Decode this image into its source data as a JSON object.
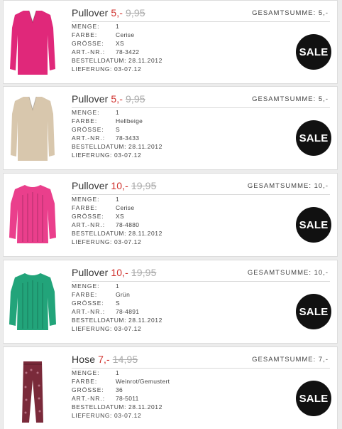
{
  "items": [
    {
      "name": "Pullover",
      "price": "5,-",
      "old_price": "9,95",
      "total_label": "GESAMTSUMME:",
      "total": "5,-",
      "menge_label": "MENGE:",
      "menge": "1",
      "farbe_label": "FARBE:",
      "farbe": "Cerise",
      "groesse_label": "GRÖSSE:",
      "groesse": "XS",
      "art_label": "ART.-NR.:",
      "art": "78-3422",
      "bestell_label": "BESTELLDATUM:",
      "bestell": "28.11.2012",
      "lieferung_label": "LIEFERUNG:",
      "lieferung": "03-07.12",
      "badge": "SALE",
      "color": "#e0287a",
      "garment": "sweater-vneck-icon"
    },
    {
      "name": "Pullover",
      "price": "5,-",
      "old_price": "9,95",
      "total_label": "GESAMTSUMME:",
      "total": "5,-",
      "menge_label": "MENGE:",
      "menge": "1",
      "farbe_label": "FARBE:",
      "farbe": "Hellbeige",
      "groesse_label": "GRÖSSE:",
      "groesse": "S",
      "art_label": "ART.-NR.:",
      "art": "78-3433",
      "bestell_label": "BESTELLDATUM:",
      "bestell": "28.11.2012",
      "lieferung_label": "LIEFERUNG:",
      "lieferung": "03-07.12",
      "badge": "SALE",
      "color": "#d8c7ad",
      "garment": "sweater-vneck-icon"
    },
    {
      "name": "Pullover",
      "price": "10,-",
      "old_price": "19,95",
      "total_label": "GESAMTSUMME:",
      "total": "10,-",
      "menge_label": "MENGE:",
      "menge": "1",
      "farbe_label": "FARBE:",
      "farbe": "Cerise",
      "groesse_label": "GRÖSSE:",
      "groesse": "XS",
      "art_label": "ART.-NR.:",
      "art": "78-4880",
      "bestell_label": "BESTELLDATUM:",
      "bestell": "28.11.2012",
      "lieferung_label": "LIEFERUNG:",
      "lieferung": "03-07.12",
      "badge": "SALE",
      "color": "#ea3f8c",
      "garment": "sweater-cable-icon"
    },
    {
      "name": "Pullover",
      "price": "10,-",
      "old_price": "19,95",
      "total_label": "GESAMTSUMME:",
      "total": "10,-",
      "menge_label": "MENGE:",
      "menge": "1",
      "farbe_label": "FARBE:",
      "farbe": "Grün",
      "groesse_label": "GRÖSSE:",
      "groesse": "S",
      "art_label": "ART.-NR.:",
      "art": "78-4891",
      "bestell_label": "BESTELLDATUM:",
      "bestell": "28.11.2012",
      "lieferung_label": "LIEFERUNG:",
      "lieferung": "03-07.12",
      "badge": "SALE",
      "color": "#22a47a",
      "garment": "sweater-cable-icon"
    },
    {
      "name": "Hose",
      "price": "7,-",
      "old_price": "14,95",
      "total_label": "GESAMTSUMME:",
      "total": "7,-",
      "menge_label": "MENGE:",
      "menge": "1",
      "farbe_label": "FARBE:",
      "farbe": "Weinrot/Gemustert",
      "groesse_label": "GRÖSSE:",
      "groesse": "36",
      "art_label": "ART.-NR.:",
      "art": "78-5011",
      "bestell_label": "BESTELLDATUM:",
      "bestell": "28.11.2012",
      "lieferung_label": "LIEFERUNG:",
      "lieferung": "03-07.12",
      "badge": "SALE",
      "color": "#7a2a3a",
      "garment": "trousers-icon"
    }
  ]
}
